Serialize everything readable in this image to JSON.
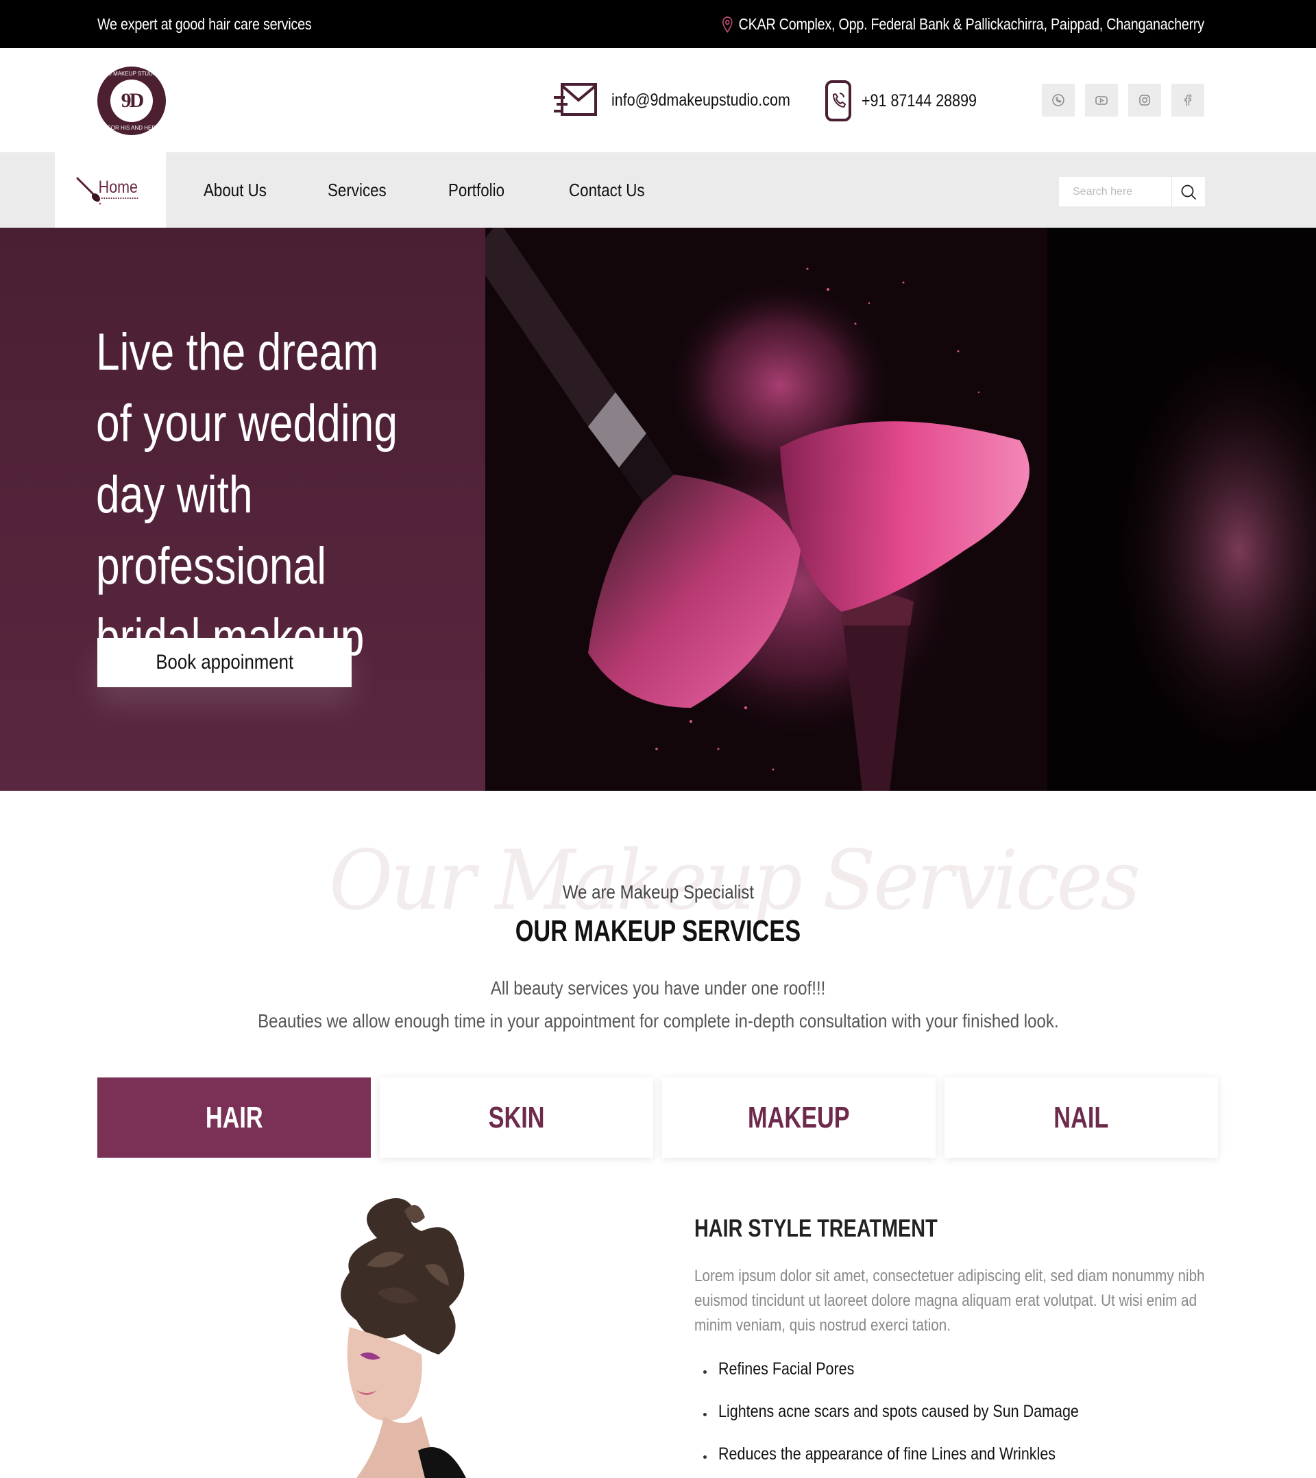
{
  "topbar": {
    "tagline": "We expert at good hair care services",
    "address": "CKAR Complex, Opp. Federal Bank & Pallickachirra, Paippad, Changanacherry"
  },
  "header": {
    "logo_mark": "9D",
    "logo_ring_top": "9D MAKEUP STUDIO",
    "logo_ring_bottom": "FOR HIS AND HER",
    "email": "info@9dmakeupstudio.com",
    "phone": "+91 87144 28899",
    "socials": [
      "whatsapp-icon",
      "youtube-icon",
      "instagram-icon",
      "facebook-icon"
    ]
  },
  "nav": {
    "items": [
      "Home",
      "About Us",
      "Services",
      "Portfolio",
      "Contact Us"
    ],
    "active": "Home",
    "search_placeholder": "Search here"
  },
  "hero": {
    "title": "Live the dream of your wedding day with professional bridal makeup",
    "button": "Book appoinment"
  },
  "services": {
    "script_text": "Our Makeup Services",
    "subheading": "We are Makeup Specialist",
    "heading": "OUR MAKEUP SERVICES",
    "desc_line1": "All beauty services you have under one roof!!!",
    "desc_line2": "Beauties we allow enough time in your appointment for complete in-depth consultation with your finished look.",
    "tabs": [
      "HAIR",
      "SKIN",
      "MAKEUP",
      "NAIL"
    ],
    "active_tab": "HAIR"
  },
  "treatment": {
    "title": "HAIR STYLE TREATMENT",
    "body": "Lorem ipsum dolor sit amet, consectetuer adipiscing elit, sed diam nonummy nibh euismod tincidunt ut laoreet dolore magna aliquam erat volutpat. Ut wisi enim ad minim veniam, quis nostrud exerci tation.",
    "bullets": [
      "Refines Facial Pores",
      "Lightens acne scars and spots caused by Sun Damage",
      "Reduces the appearance of fine Lines and Wrinkles"
    ]
  },
  "colors": {
    "brand": "#4a1f33",
    "accent": "#7a3155",
    "topbar": "#000000",
    "nav_bg": "#ebebeb"
  }
}
